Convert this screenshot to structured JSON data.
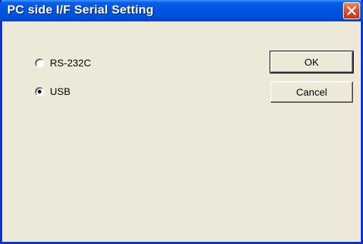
{
  "window": {
    "title": "PC side I/F Serial Setting",
    "close_icon": "close-icon"
  },
  "options": [
    {
      "label": "RS-232C",
      "selected": false
    },
    {
      "label": "USB",
      "selected": true
    }
  ],
  "buttons": {
    "ok_label": "OK",
    "cancel_label": "Cancel"
  }
}
